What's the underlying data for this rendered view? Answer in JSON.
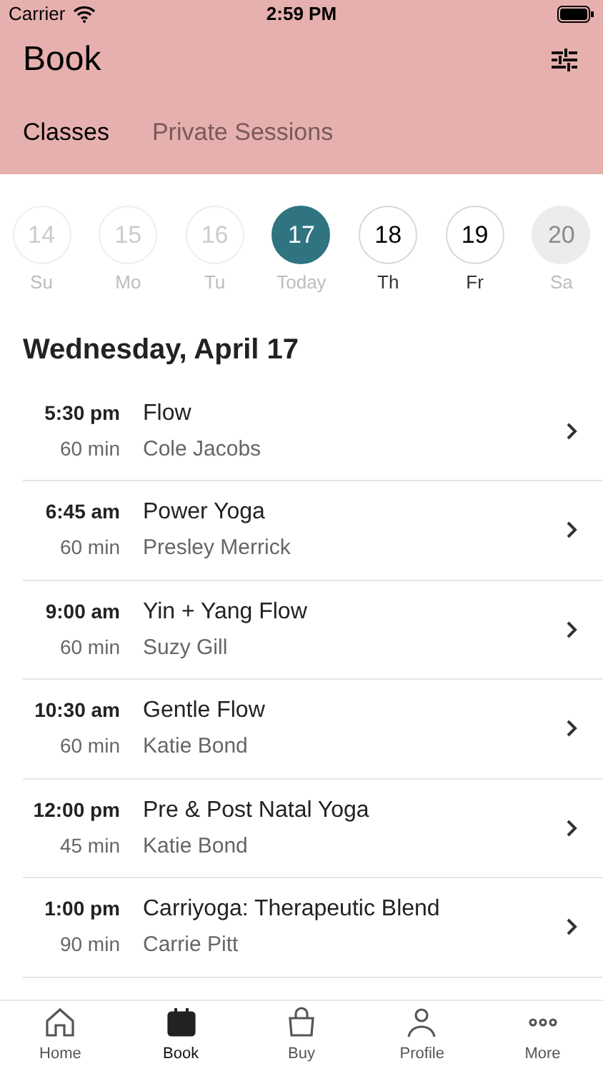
{
  "status_bar": {
    "carrier": "Carrier",
    "time": "2:59 PM"
  },
  "header": {
    "title": "Book"
  },
  "tabs": [
    {
      "label": "Classes",
      "selected": true
    },
    {
      "label": "Private Sessions",
      "selected": false
    }
  ],
  "days": [
    {
      "date": "14",
      "label": "Su",
      "kind": "past",
      "selected": false
    },
    {
      "date": "15",
      "label": "Mo",
      "kind": "past",
      "selected": false
    },
    {
      "date": "16",
      "label": "Tu",
      "kind": "past",
      "selected": false
    },
    {
      "date": "17",
      "label": "Today",
      "kind": "past",
      "selected": true
    },
    {
      "date": "18",
      "label": "Th",
      "kind": "open",
      "selected": false
    },
    {
      "date": "19",
      "label": "Fr",
      "kind": "open",
      "selected": false
    },
    {
      "date": "20",
      "label": "Sa",
      "kind": "closed",
      "selected": false
    }
  ],
  "day_heading": "Wednesday, April 17",
  "classes": [
    {
      "time": "5:30 pm",
      "duration": "60 min",
      "name": "Flow",
      "teacher": "Cole Jacobs"
    },
    {
      "time": "6:45 am",
      "duration": "60 min",
      "name": "Power Yoga",
      "teacher": "Presley Merrick"
    },
    {
      "time": "9:00 am",
      "duration": "60 min",
      "name": "Yin + Yang Flow",
      "teacher": "Suzy Gill"
    },
    {
      "time": "10:30 am",
      "duration": "60 min",
      "name": "Gentle Flow",
      "teacher": "Katie Bond"
    },
    {
      "time": "12:00 pm",
      "duration": "45 min",
      "name": "Pre & Post Natal Yoga",
      "teacher": "Katie Bond"
    },
    {
      "time": "1:00 pm",
      "duration": "90 min",
      "name": "Carriyoga: Therapeutic Blend",
      "teacher": "Carrie Pitt"
    }
  ],
  "tab_bar": [
    {
      "label": "Home",
      "kind": "home",
      "selected": false
    },
    {
      "label": "Book",
      "kind": "book",
      "selected": true
    },
    {
      "label": "Buy",
      "kind": "buy",
      "selected": false
    },
    {
      "label": "Profile",
      "kind": "profile",
      "selected": false
    },
    {
      "label": "More",
      "kind": "more",
      "selected": false
    }
  ]
}
